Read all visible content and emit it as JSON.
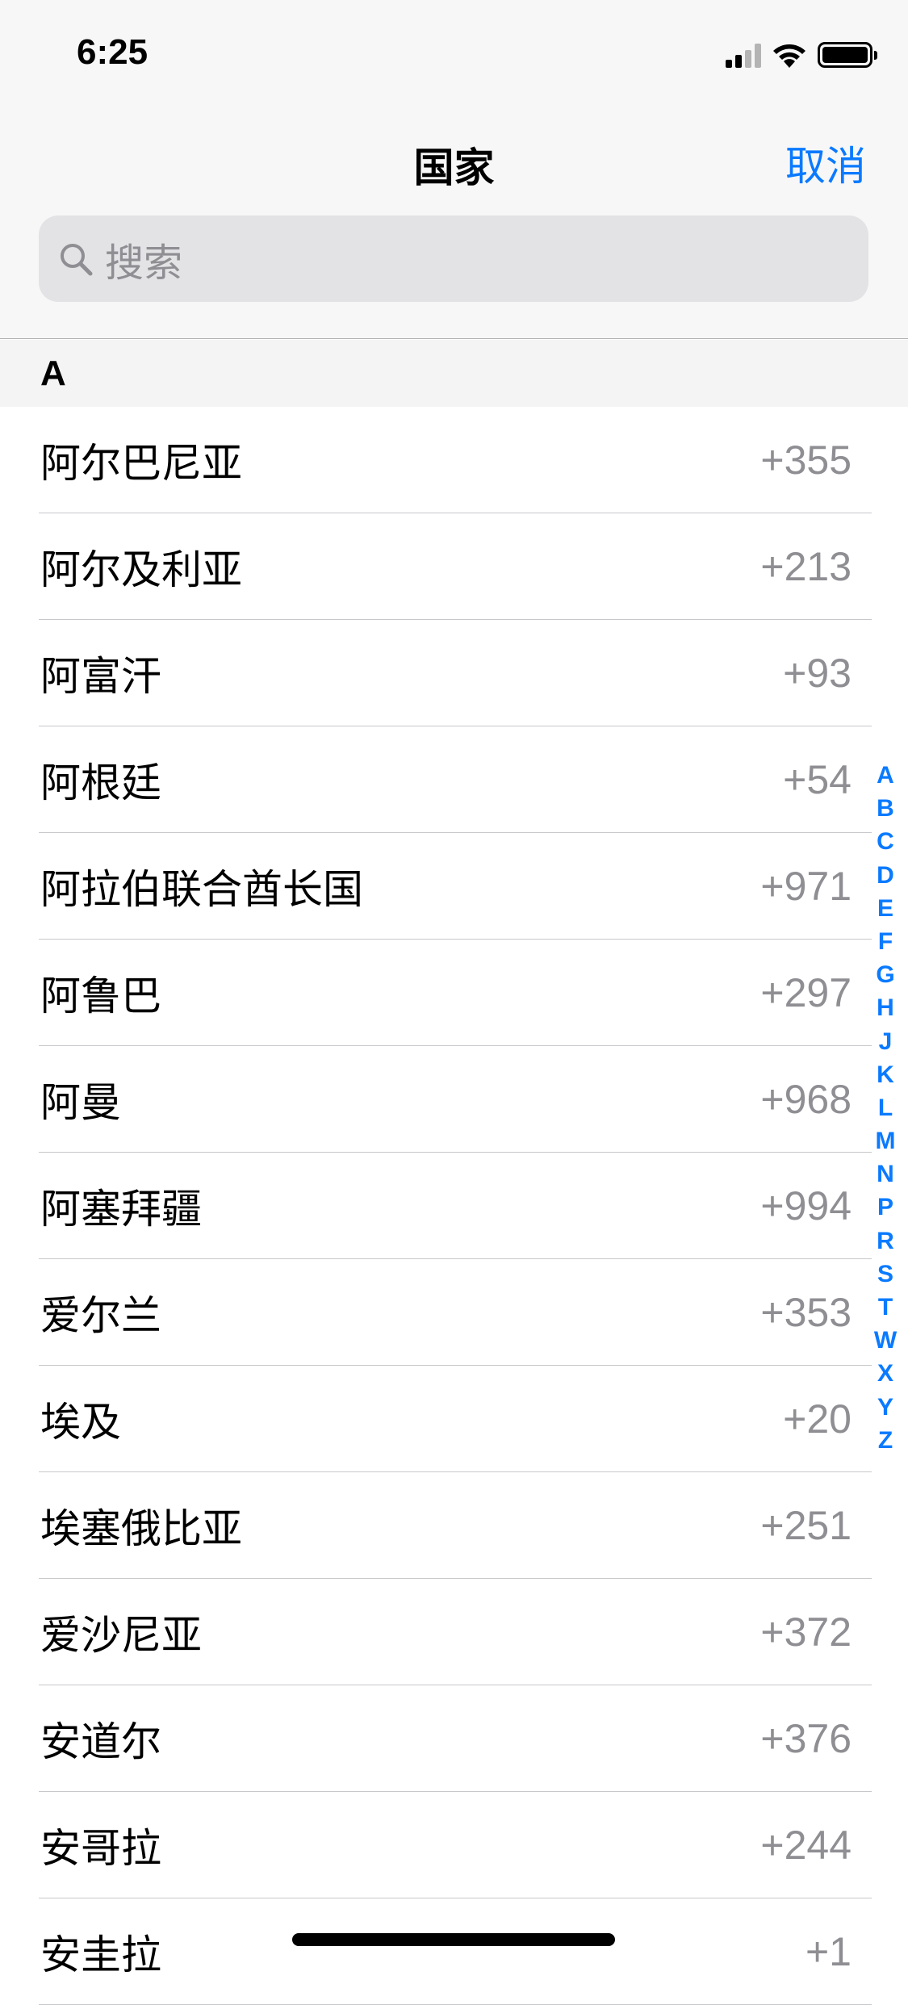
{
  "status_bar": {
    "time": "6:25"
  },
  "nav": {
    "title": "国家",
    "cancel_label": "取消"
  },
  "search": {
    "placeholder": "搜索"
  },
  "section": {
    "header": "A"
  },
  "rows": [
    {
      "name": "阿尔巴尼亚",
      "code": "+355"
    },
    {
      "name": "阿尔及利亚",
      "code": "+213"
    },
    {
      "name": "阿富汗",
      "code": "+93"
    },
    {
      "name": "阿根廷",
      "code": "+54"
    },
    {
      "name": "阿拉伯联合酋长国",
      "code": "+971"
    },
    {
      "name": "阿鲁巴",
      "code": "+297"
    },
    {
      "name": "阿曼",
      "code": "+968"
    },
    {
      "name": "阿塞拜疆",
      "code": "+994"
    },
    {
      "name": "爱尔兰",
      "code": "+353"
    },
    {
      "name": "埃及",
      "code": "+20"
    },
    {
      "name": "埃塞俄比亚",
      "code": "+251"
    },
    {
      "name": "爱沙尼亚",
      "code": "+372"
    },
    {
      "name": "安道尔",
      "code": "+376"
    },
    {
      "name": "安哥拉",
      "code": "+244"
    },
    {
      "name": "安圭拉",
      "code": "+1"
    }
  ],
  "index": [
    "A",
    "B",
    "C",
    "D",
    "E",
    "F",
    "G",
    "H",
    "J",
    "K",
    "L",
    "M",
    "N",
    "P",
    "R",
    "S",
    "T",
    "W",
    "X",
    "Y",
    "Z"
  ],
  "colors": {
    "accent": "#0a7aff",
    "secondary_text": "#8e8e93"
  }
}
